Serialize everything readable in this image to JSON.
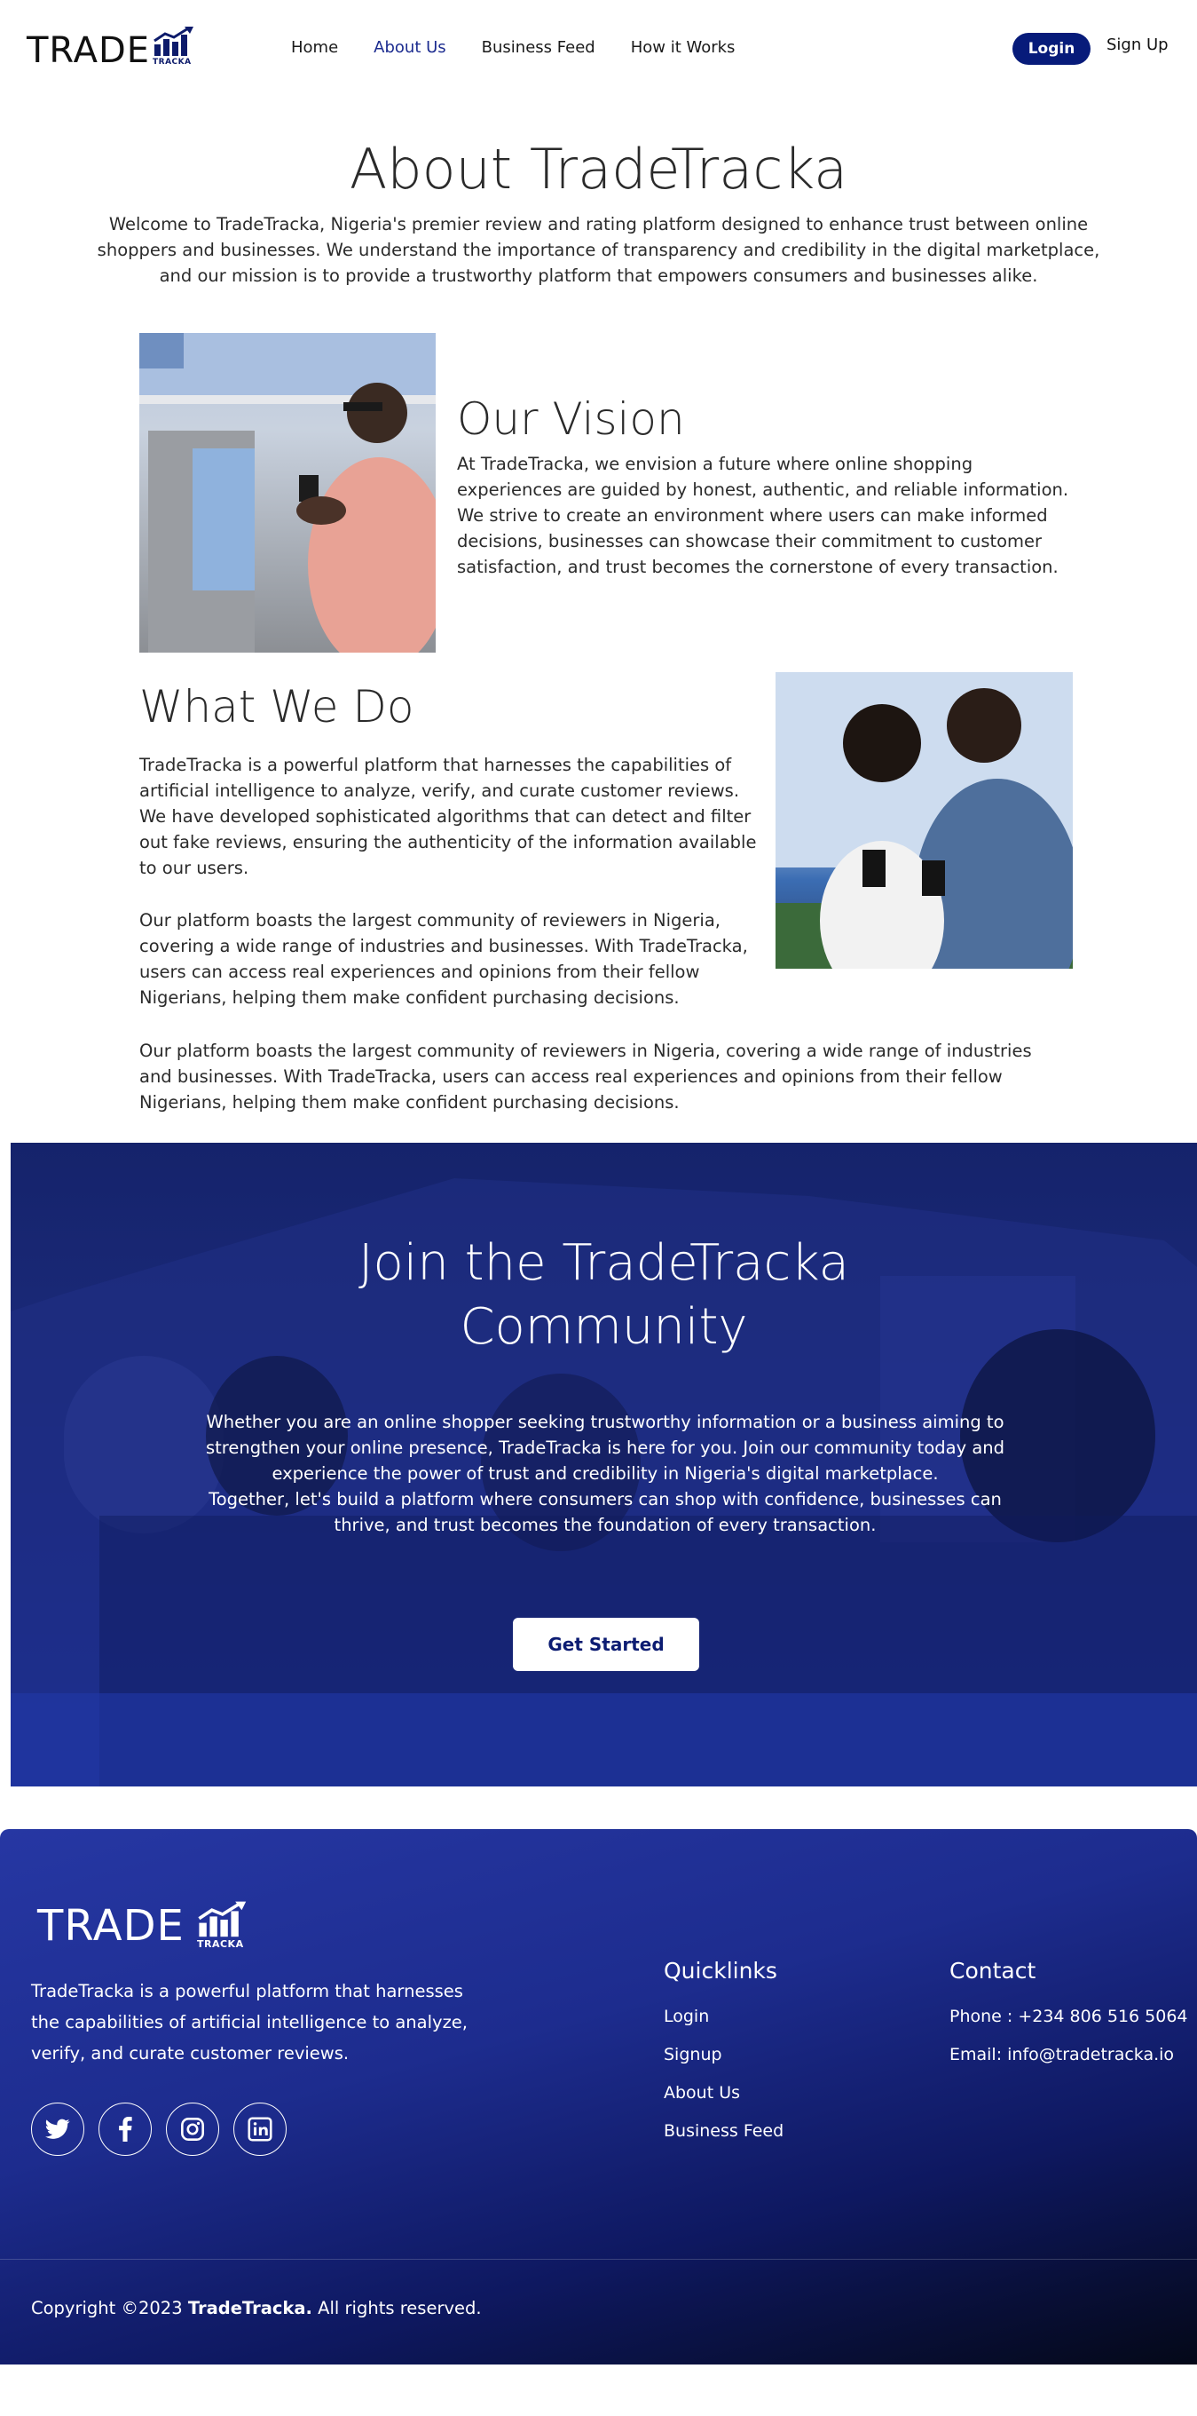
{
  "nav": {
    "logo_word": "TRADE",
    "logo_sub": "TRACKA",
    "links": [
      {
        "label": "Home",
        "active": false
      },
      {
        "label": "About Us",
        "active": true
      },
      {
        "label": "Business Feed",
        "active": false
      },
      {
        "label": "How it Works",
        "active": false
      }
    ],
    "login_label": "Login",
    "signup_label": "Sign Up"
  },
  "about": {
    "title": "About TradeTracka",
    "intro": "Welcome to TradeTracka, Nigeria's premier review and rating platform designed to enhance trust between online shoppers and businesses. We understand the importance of transparency and credibility in the digital marketplace, and our mission is to provide a trustworthy platform that empowers consumers and businesses alike."
  },
  "vision": {
    "title": "Our Vision",
    "body": "At TradeTracka, we envision a future where online shopping experiences are guided by honest, authentic, and reliable information. We strive to create an environment where users can make informed decisions, businesses can showcase their commitment to customer satisfaction, and trust becomes the cornerstone of every transaction."
  },
  "what_we_do": {
    "title": "What We Do",
    "p1": "TradeTracka is a powerful platform that harnesses the capabilities of artificial intelligence to analyze, verify, and curate customer reviews. We have developed sophisticated algorithms that can detect and filter out fake reviews, ensuring the authenticity of the information available to our users.",
    "p2": "Our platform boasts the largest community of reviewers in Nigeria, covering a wide range of industries and businesses. With TradeTracka, users can access real experiences and opinions from their fellow Nigerians, helping them make confident purchasing decisions.",
    "p3": "Our platform boasts the largest community of reviewers in Nigeria, covering a wide range of industries and businesses. With TradeTracka, users can access real experiences and opinions from their fellow Nigerians, helping them make confident purchasing decisions."
  },
  "join": {
    "title_line1": "Join the TradeTracka",
    "title_line2": "Community",
    "body_line1": "Whether you are an online shopper seeking trustworthy information or a business aiming to strengthen your online presence, TradeTracka is here for you. Join our community today and experience the power of trust and credibility in Nigeria's digital marketplace.",
    "body_line2": "Together, let's build a platform where consumers can shop with confidence, businesses can thrive, and trust becomes the foundation of every transaction.",
    "button_label": "Get Started"
  },
  "footer": {
    "logo_word": "TRADE",
    "logo_sub": "TRACKA",
    "description": "TradeTracka is a powerful platform that harnesses the capabilities of artificial intelligence to analyze, verify, and curate customer reviews.",
    "socials": [
      "twitter-icon",
      "facebook-icon",
      "instagram-icon",
      "linkedin-icon"
    ],
    "quicklinks_title": "Quicklinks",
    "quicklinks": [
      "Login",
      "Signup",
      "About Us",
      "Business Feed"
    ],
    "contact_title": "Contact",
    "phone": "Phone : +234 806 516 5064",
    "email": "Email: info@tradetracka.io",
    "copyright_prefix": "Copyright ©2023 ",
    "copyright_brand": "TradeTracka.",
    "copyright_suffix": " All rights reserved."
  },
  "colors": {
    "brand_navy": "#071b7a",
    "active_link": "#1b2b8f"
  }
}
